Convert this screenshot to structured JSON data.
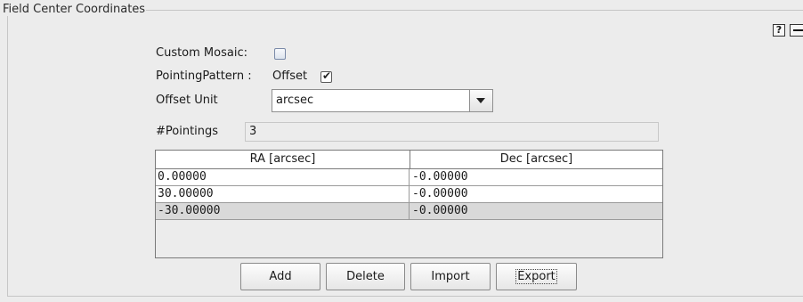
{
  "panel": {
    "title": "Field Center Coordinates"
  },
  "controls": {
    "help": "?"
  },
  "custom_mosaic": {
    "label": "Custom Mosaic:",
    "checked": false
  },
  "pointing_pattern": {
    "label": "PointingPattern :",
    "value": "Offset",
    "checked": true,
    "check_glyph": "✔"
  },
  "offset_unit": {
    "label": "Offset Unit",
    "selected": "arcsec"
  },
  "pointings": {
    "label": "#Pointings",
    "value": "3"
  },
  "table": {
    "columns": [
      "RA [arcsec]",
      "Dec [arcsec]"
    ],
    "rows": [
      [
        "0.00000",
        "-0.00000"
      ],
      [
        "30.00000",
        "-0.00000"
      ],
      [
        "-30.00000",
        "-0.00000"
      ]
    ],
    "selected_row": 2
  },
  "buttons": {
    "add": "Add",
    "delete": "Delete",
    "import": "Import",
    "export": "Export"
  }
}
